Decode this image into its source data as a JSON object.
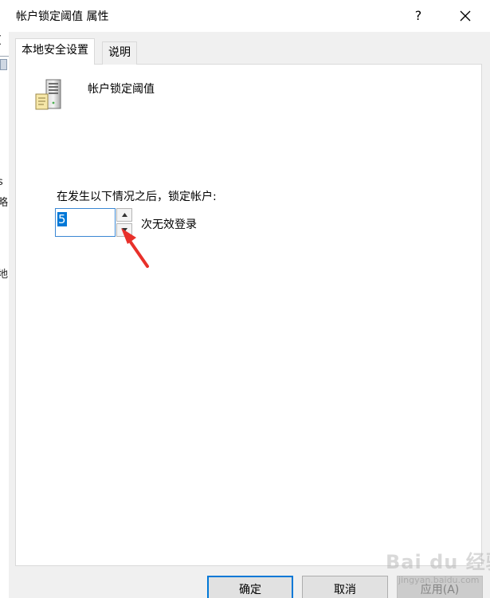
{
  "background_window": {
    "fragments": [
      "(",
      "s",
      "略",
      "地"
    ]
  },
  "dialog": {
    "title": "帐户锁定阈值 属性",
    "help_label": "?",
    "tabs": [
      {
        "label": "本地安全设置",
        "active": true
      },
      {
        "label": "说明",
        "active": false
      }
    ],
    "policy_name": "帐户锁定阈值",
    "prompt": "在发生以下情况之后，锁定帐户:",
    "threshold_value": "5",
    "suffix": "次无效登录",
    "buttons": {
      "ok": "确定",
      "cancel": "取消",
      "apply": "应用(A)"
    }
  },
  "watermark": {
    "text": "Bai du 经验",
    "url": "jingyan.baidu.com"
  },
  "colors": {
    "accent": "#0078d7",
    "annotation_arrow": "#e8302a"
  }
}
